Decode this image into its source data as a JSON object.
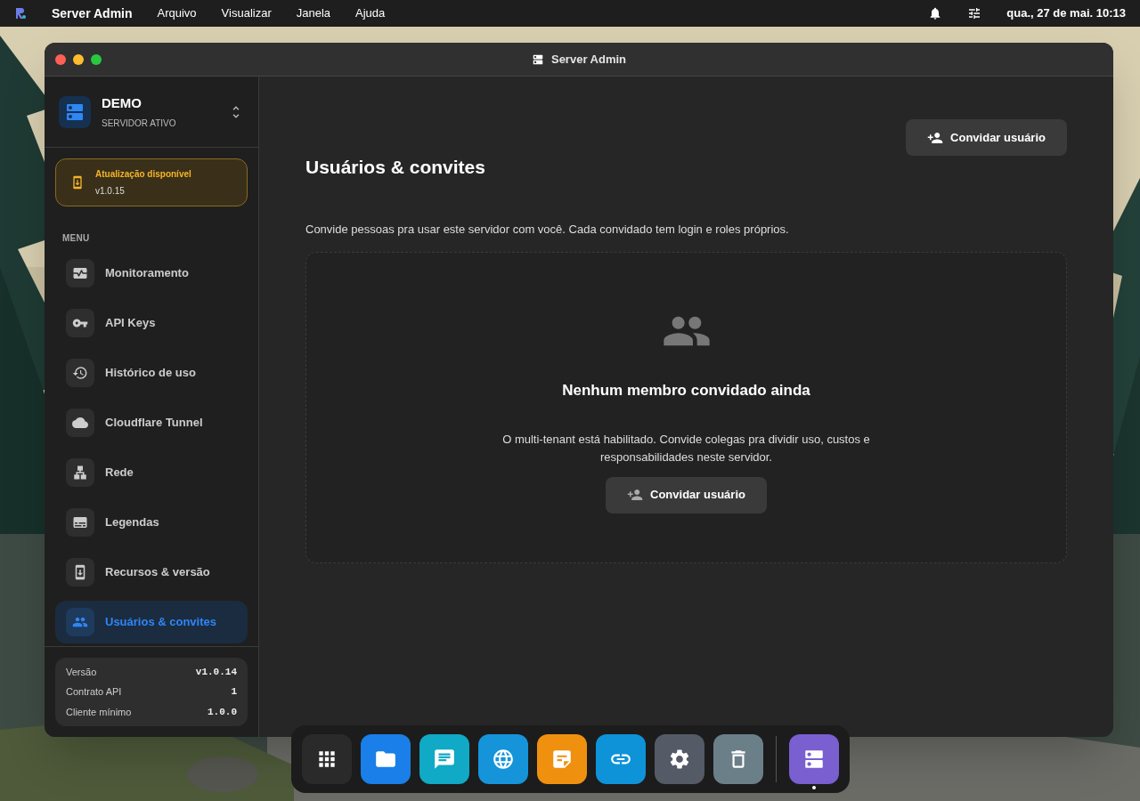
{
  "menubar": {
    "app_name": "Server Admin",
    "menus": [
      "Arquivo",
      "Visualizar",
      "Janela",
      "Ajuda"
    ],
    "clock": "qua., 27 de mai. 10:13"
  },
  "window": {
    "title": "Server Admin"
  },
  "sidebar": {
    "server": {
      "name": "DEMO",
      "status": "SERVIDOR ATIVO"
    },
    "update": {
      "title": "Atualização disponível",
      "version": "v1.0.15"
    },
    "section": "MENU",
    "items": [
      {
        "label": "Monitoramento",
        "selected": false
      },
      {
        "label": "API Keys",
        "selected": false
      },
      {
        "label": "Histórico de uso",
        "selected": false
      },
      {
        "label": "Cloudflare Tunnel",
        "selected": false
      },
      {
        "label": "Rede",
        "selected": false
      },
      {
        "label": "Legendas",
        "selected": false
      },
      {
        "label": "Recursos & versão",
        "selected": false
      },
      {
        "label": "Usuários & convites",
        "selected": true
      }
    ],
    "info": [
      {
        "label": "Versão",
        "value": "v1.0.14"
      },
      {
        "label": "Contrato API",
        "value": "1"
      },
      {
        "label": "Cliente mínimo",
        "value": "1.0.0"
      }
    ]
  },
  "main": {
    "title": "Usuários & convites",
    "invite_button": "Convidar usuário",
    "description": "Convide pessoas pra usar este servidor com você. Cada convidado tem login e roles próprios.",
    "empty": {
      "title": "Nenhum membro convidado ainda",
      "text": "O multi-tenant está habilitado. Convide colegas pra dividir uso, custos e responsabilidades neste servidor.",
      "button": "Convidar usuário"
    }
  },
  "dock": [
    {
      "running": false
    },
    {
      "running": false
    },
    {
      "running": false
    },
    {
      "running": false
    },
    {
      "running": false
    },
    {
      "running": false
    },
    {
      "running": false
    },
    {
      "running": false
    },
    {
      "running": true
    }
  ]
}
